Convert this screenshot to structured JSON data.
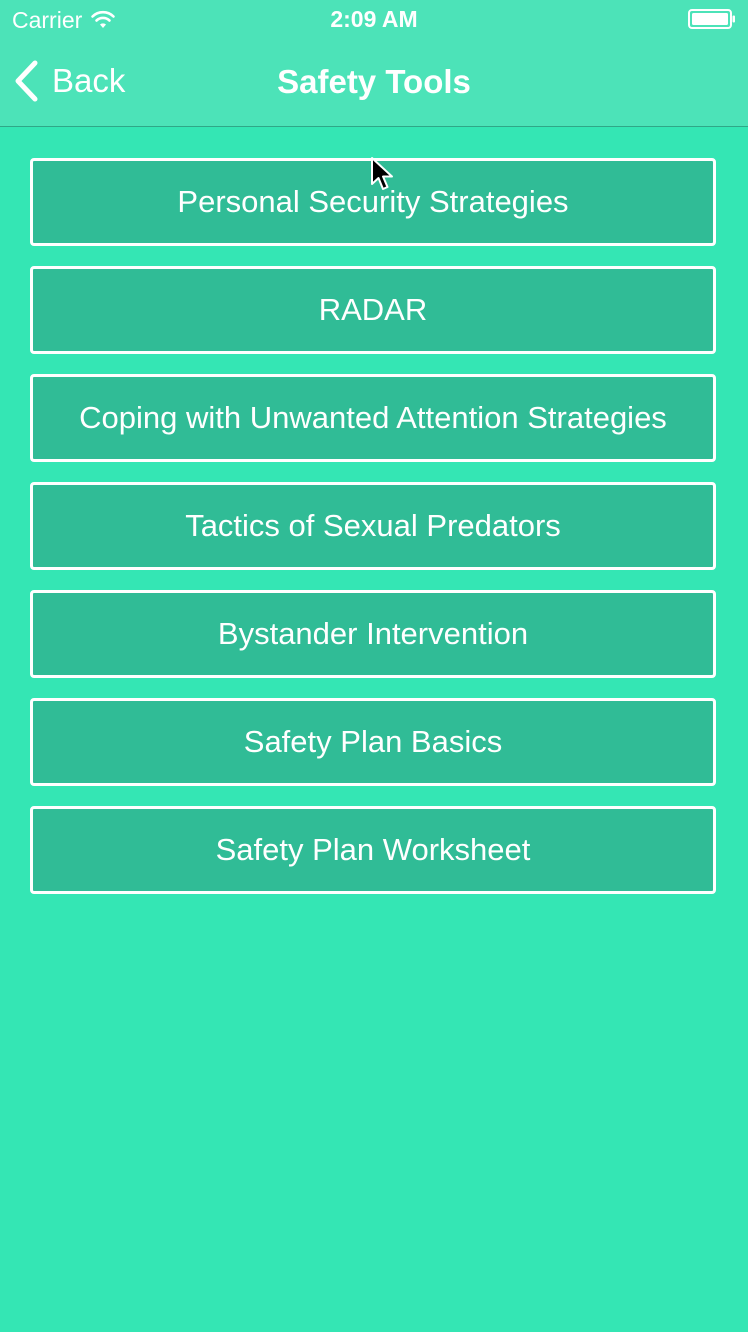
{
  "status_bar": {
    "carrier": "Carrier",
    "time": "2:09 AM",
    "wifi_icon": "wifi-icon",
    "battery_icon": "battery-icon"
  },
  "nav": {
    "back_label": "Back",
    "back_icon": "chevron-left-icon",
    "title": "Safety Tools"
  },
  "menu": {
    "items": [
      {
        "label": "Personal Security Strategies"
      },
      {
        "label": "RADAR"
      },
      {
        "label": "Coping with Unwanted Attention Strategies"
      },
      {
        "label": "Tactics of Sexual Predators"
      },
      {
        "label": "Bystander Intervention"
      },
      {
        "label": "Safety Plan Basics"
      },
      {
        "label": "Safety Plan Worksheet"
      }
    ]
  },
  "colors": {
    "background": "#34e6b4",
    "nav_background": "#4ce3b8",
    "button_fill": "#30bc96",
    "button_border": "#ffffff",
    "text": "#ffffff"
  }
}
